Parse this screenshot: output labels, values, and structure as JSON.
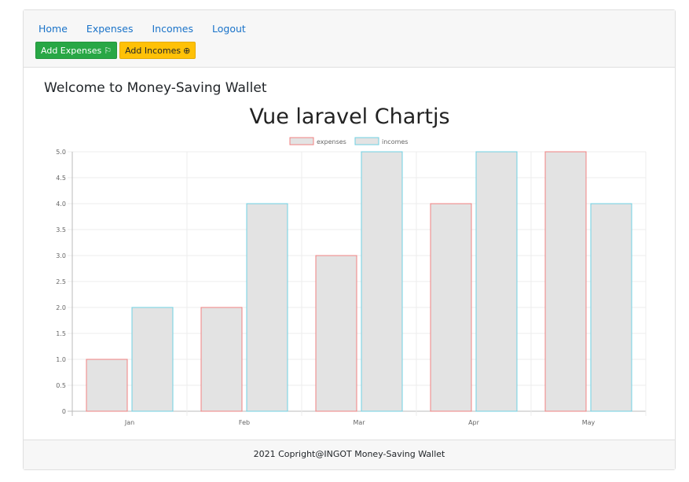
{
  "nav": {
    "items": [
      "Home",
      "Expenses",
      "Incomes",
      "Logout"
    ]
  },
  "buttons": {
    "add_expenses": "Add Expenses",
    "add_expenses_icon": "flag-icon",
    "add_incomes": "Add Incomes",
    "add_incomes_icon": "plus-circle-icon"
  },
  "welcome": "Welcome to Money-Saving Wallet",
  "footer": "2021 Copright@INGOT Money-Saving Wallet",
  "colors": {
    "expenses_border": "#f08080",
    "incomes_border": "#6fd0e3",
    "bar_fill": "#e3e3e3",
    "add_expenses_bg": "#28a745",
    "add_incomes_bg": "#ffc107",
    "link": "#1a73c9"
  },
  "chart_data": {
    "type": "bar",
    "title": "Vue laravel Chartjs",
    "categories": [
      "Jan",
      "Feb",
      "Mar",
      "Apr",
      "May"
    ],
    "series": [
      {
        "name": "expenses",
        "values": [
          1,
          2,
          3,
          4,
          5
        ]
      },
      {
        "name": "incomes",
        "values": [
          2,
          4,
          5,
          5,
          4
        ]
      }
    ],
    "ylim": [
      0,
      5
    ],
    "yticks": [
      "0",
      "0.5",
      "1.0",
      "1.5",
      "2.0",
      "2.5",
      "3.0",
      "3.5",
      "4.0",
      "4.5",
      "5.0"
    ],
    "grid": true,
    "legend_position": "top"
  }
}
